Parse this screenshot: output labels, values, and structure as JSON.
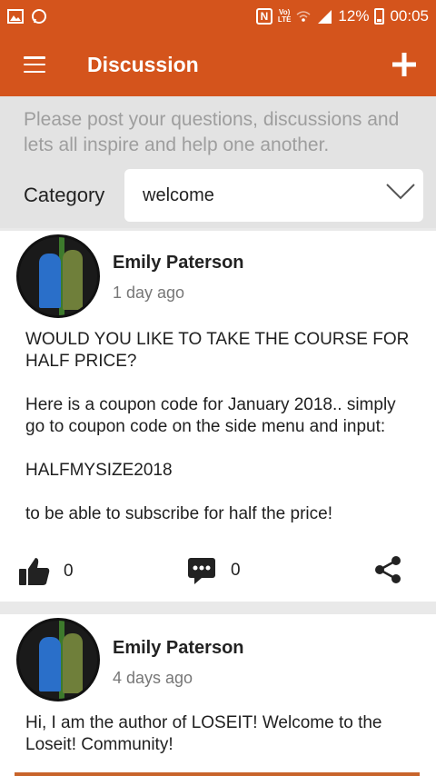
{
  "status_bar": {
    "battery": "12%",
    "time": "00:05",
    "icons": [
      "image-icon",
      "whatsapp-icon",
      "nfc-icon",
      "volte-icon",
      "wifi-icon",
      "signal-icon",
      "battery-icon"
    ]
  },
  "app_bar": {
    "title": "Discussion",
    "menu_icon": "hamburger-icon",
    "add_icon": "plus-icon"
  },
  "intro": {
    "text": "Please post your questions, discussions and lets all inspire and help one another."
  },
  "category": {
    "label": "Category",
    "selected": "welcome"
  },
  "posts": [
    {
      "author": "Emily Paterson",
      "time": "1 day ago",
      "body": "WOULD YOU LIKE TO TAKE THE COURSE FOR HALF PRICE?\n\nHere is a coupon code for January 2018.. simply go to coupon code on the side menu and input:\n\nHALFMYSIZE2018\n\nto be able to subscribe for half the price!",
      "likes": "0",
      "comments": "0"
    },
    {
      "author": "Emily Paterson",
      "time": "4 days ago",
      "body": "Hi, I am the author of LOSEIT!  Welcome to the Loseit! Community!"
    }
  ],
  "colors": {
    "accent": "#d4541c",
    "background": "#e9e9e9",
    "card": "#ffffff"
  }
}
